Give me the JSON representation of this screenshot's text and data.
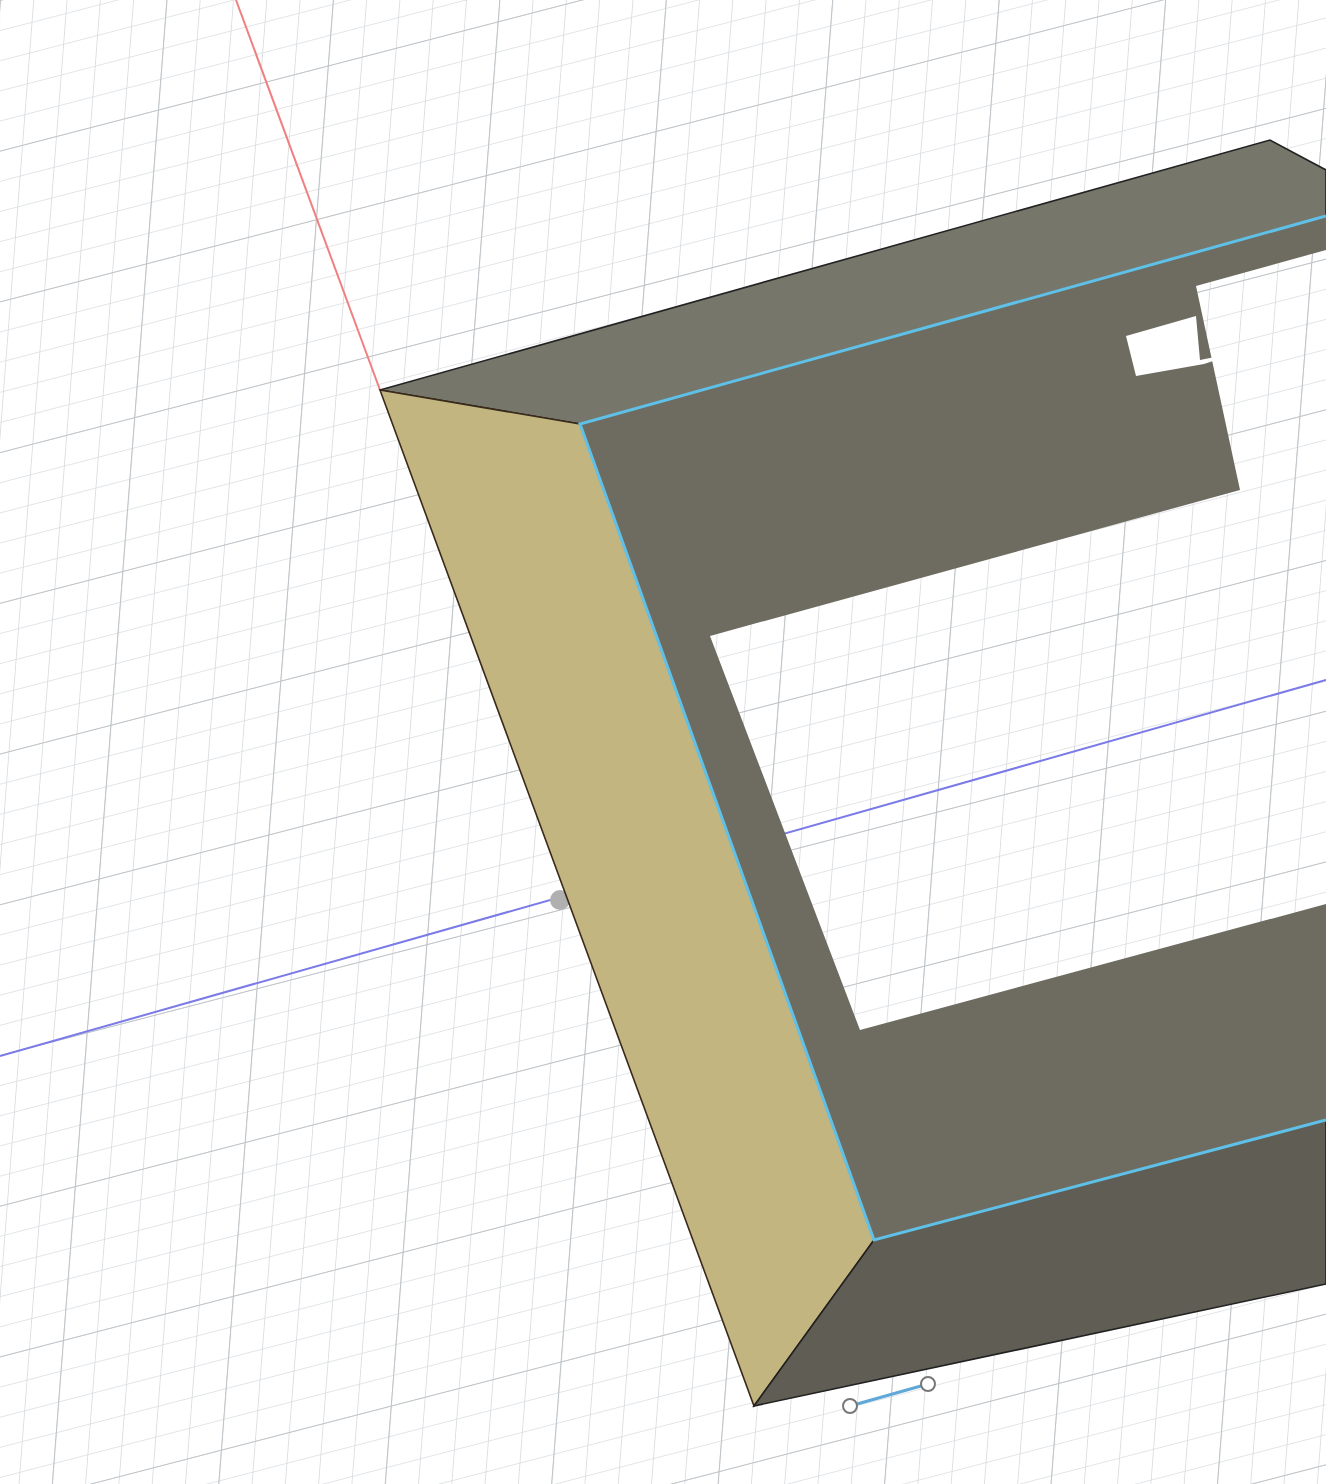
{
  "viewport": {
    "kind": "model"
  }
}
